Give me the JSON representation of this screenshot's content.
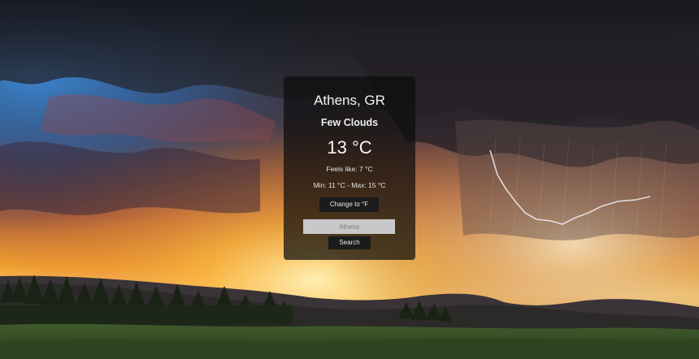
{
  "weather": {
    "city": "Athens, GR",
    "description": "Few Clouds",
    "temperature": "13 °C",
    "feels_like": "Feels like: 7 °C",
    "min_max": "Min: 11 °C - Max: 15 °C"
  },
  "controls": {
    "unit_button_label": "Change to °F",
    "search_input_value": "Athens",
    "search_input_placeholder": "Athens",
    "search_button_label": "Search"
  }
}
